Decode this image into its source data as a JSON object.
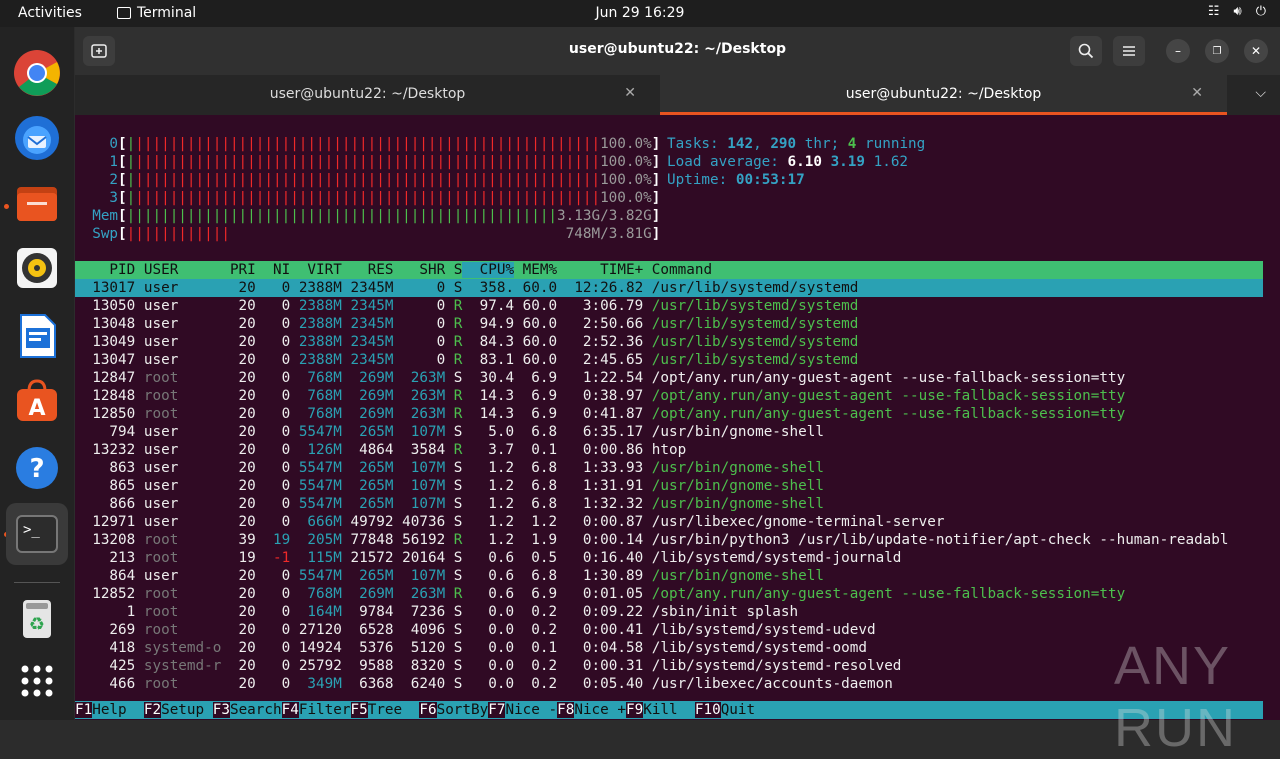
{
  "topbar": {
    "activities": "Activities",
    "app_name": "Terminal",
    "clock": "Jun 29  16:29",
    "tray_icons": [
      "network-icon",
      "volume-icon",
      "power-icon"
    ]
  },
  "dock": {
    "items": [
      "chrome-icon",
      "thunderbird-icon",
      "files-icon",
      "rhythmbox-icon",
      "libreoffice-writer-icon",
      "app-center-icon",
      "help-icon",
      "terminal-icon",
      "trash-icon",
      "show-apps-icon"
    ]
  },
  "window": {
    "title": "user@ubuntu22: ~/Desktop",
    "tabs": [
      {
        "label": "user@ubuntu22: ~/Desktop",
        "active": false
      },
      {
        "label": "user@ubuntu22: ~/Desktop",
        "active": true
      }
    ]
  },
  "htop": {
    "cpus": [
      {
        "id": "0",
        "pct": "100.0%"
      },
      {
        "id": "1",
        "pct": "100.0%"
      },
      {
        "id": "2",
        "pct": "100.0%"
      },
      {
        "id": "3",
        "pct": "100.0%"
      }
    ],
    "mem": {
      "label": "Mem",
      "used": "3.13G",
      "total": "3.82G"
    },
    "swap": {
      "label": "Swp",
      "used": "748M",
      "total": "3.81G"
    },
    "tasks": {
      "label": "Tasks:",
      "count": "142",
      "threads": "290",
      "thr_label": "thr;",
      "running": "4",
      "running_label": "running"
    },
    "load": {
      "label": "Load average:",
      "v1": "6.10",
      "v5": "3.19",
      "v15": "1.62"
    },
    "uptime": {
      "label": "Uptime:",
      "value": "00:53:17"
    },
    "columns": [
      "PID",
      "USER",
      "PRI",
      "NI",
      "VIRT",
      "RES",
      "SHR",
      "S",
      "CPU%",
      "MEM%",
      "TIME+",
      "Command"
    ],
    "processes": [
      [
        "13017",
        "user",
        "20",
        "0",
        "2388M",
        "2345M",
        "0",
        "S",
        "358.",
        "60.0",
        "12:26.82",
        "/usr/lib/systemd/systemd"
      ],
      [
        "13050",
        "user",
        "20",
        "0",
        "2388M",
        "2345M",
        "0",
        "R",
        "97.4",
        "60.0",
        "3:06.79",
        "/usr/lib/systemd/systemd"
      ],
      [
        "13048",
        "user",
        "20",
        "0",
        "2388M",
        "2345M",
        "0",
        "R",
        "94.9",
        "60.0",
        "2:50.66",
        "/usr/lib/systemd/systemd"
      ],
      [
        "13049",
        "user",
        "20",
        "0",
        "2388M",
        "2345M",
        "0",
        "R",
        "84.3",
        "60.0",
        "2:52.36",
        "/usr/lib/systemd/systemd"
      ],
      [
        "13047",
        "user",
        "20",
        "0",
        "2388M",
        "2345M",
        "0",
        "R",
        "83.1",
        "60.0",
        "2:45.65",
        "/usr/lib/systemd/systemd"
      ],
      [
        "12847",
        "root",
        "20",
        "0",
        "768M",
        "269M",
        "263M",
        "S",
        "30.4",
        "6.9",
        "1:22.54",
        "/opt/any.run/any-guest-agent --use-fallback-session=tty"
      ],
      [
        "12848",
        "root",
        "20",
        "0",
        "768M",
        "269M",
        "263M",
        "R",
        "14.3",
        "6.9",
        "0:38.97",
        "/opt/any.run/any-guest-agent --use-fallback-session=tty"
      ],
      [
        "12850",
        "root",
        "20",
        "0",
        "768M",
        "269M",
        "263M",
        "R",
        "14.3",
        "6.9",
        "0:41.87",
        "/opt/any.run/any-guest-agent --use-fallback-session=tty"
      ],
      [
        "794",
        "user",
        "20",
        "0",
        "5547M",
        "265M",
        "107M",
        "S",
        "5.0",
        "6.8",
        "6:35.17",
        "/usr/bin/gnome-shell"
      ],
      [
        "13232",
        "user",
        "20",
        "0",
        "126M",
        "4864",
        "3584",
        "R",
        "3.7",
        "0.1",
        "0:00.86",
        "htop"
      ],
      [
        "863",
        "user",
        "20",
        "0",
        "5547M",
        "265M",
        "107M",
        "S",
        "1.2",
        "6.8",
        "1:33.93",
        "/usr/bin/gnome-shell"
      ],
      [
        "865",
        "user",
        "20",
        "0",
        "5547M",
        "265M",
        "107M",
        "S",
        "1.2",
        "6.8",
        "1:31.91",
        "/usr/bin/gnome-shell"
      ],
      [
        "866",
        "user",
        "20",
        "0",
        "5547M",
        "265M",
        "107M",
        "S",
        "1.2",
        "6.8",
        "1:32.32",
        "/usr/bin/gnome-shell"
      ],
      [
        "12971",
        "user",
        "20",
        "0",
        "666M",
        "49792",
        "40736",
        "S",
        "1.2",
        "1.2",
        "0:00.87",
        "/usr/libexec/gnome-terminal-server"
      ],
      [
        "13208",
        "root",
        "39",
        "19",
        "205M",
        "77848",
        "56192",
        "R",
        "1.2",
        "1.9",
        "0:00.14",
        "/usr/bin/python3 /usr/lib/update-notifier/apt-check --human-readabl"
      ],
      [
        "213",
        "root",
        "19",
        "-1",
        "115M",
        "21572",
        "20164",
        "S",
        "0.6",
        "0.5",
        "0:16.40",
        "/lib/systemd/systemd-journald"
      ],
      [
        "864",
        "user",
        "20",
        "0",
        "5547M",
        "265M",
        "107M",
        "S",
        "0.6",
        "6.8",
        "1:30.89",
        "/usr/bin/gnome-shell"
      ],
      [
        "12852",
        "root",
        "20",
        "0",
        "768M",
        "269M",
        "263M",
        "R",
        "0.6",
        "6.9",
        "0:01.05",
        "/opt/any.run/any-guest-agent --use-fallback-session=tty"
      ],
      [
        "1",
        "root",
        "20",
        "0",
        "164M",
        "9784",
        "7236",
        "S",
        "0.0",
        "0.2",
        "0:09.22",
        "/sbin/init splash"
      ],
      [
        "269",
        "root",
        "20",
        "0",
        "27120",
        "6528",
        "4096",
        "S",
        "0.0",
        "0.2",
        "0:00.41",
        "/lib/systemd/systemd-udevd"
      ],
      [
        "418",
        "systemd-o",
        "20",
        "0",
        "14924",
        "5376",
        "5120",
        "S",
        "0.0",
        "0.1",
        "0:04.58",
        "/lib/systemd/systemd-oomd"
      ],
      [
        "425",
        "systemd-r",
        "20",
        "0",
        "25792",
        "9588",
        "8320",
        "S",
        "0.0",
        "0.2",
        "0:00.31",
        "/lib/systemd/systemd-resolved"
      ],
      [
        "466",
        "root",
        "20",
        "0",
        "349M",
        "6368",
        "6240",
        "S",
        "0.0",
        "0.2",
        "0:05.40",
        "/usr/libexec/accounts-daemon"
      ]
    ],
    "fkeys": [
      {
        "key": "F1",
        "label": "Help  "
      },
      {
        "key": "F2",
        "label": "Setup "
      },
      {
        "key": "F3",
        "label": "Search"
      },
      {
        "key": "F4",
        "label": "Filter"
      },
      {
        "key": "F5",
        "label": "Tree  "
      },
      {
        "key": "F6",
        "label": "SortBy"
      },
      {
        "key": "F7",
        "label": "Nice -"
      },
      {
        "key": "F8",
        "label": "Nice +"
      },
      {
        "key": "F9",
        "label": "Kill  "
      },
      {
        "key": "F10",
        "label": "Quit"
      }
    ]
  },
  "watermark": "ANY RUN"
}
